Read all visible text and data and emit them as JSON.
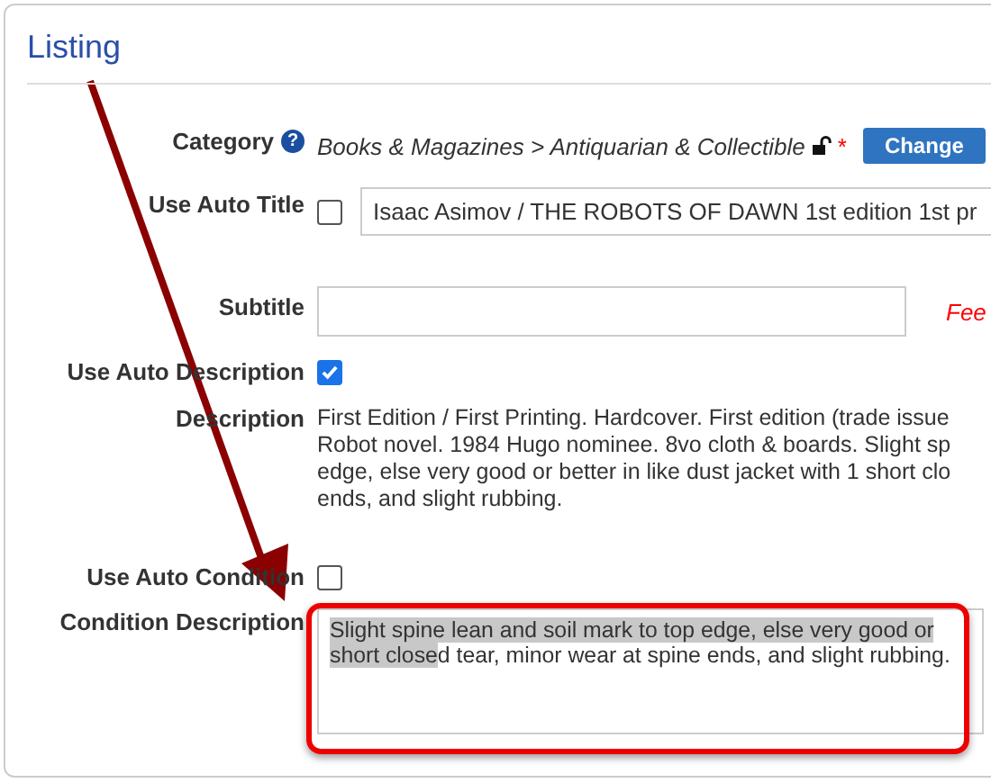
{
  "panel": {
    "title": "Listing"
  },
  "category": {
    "label": "Category",
    "help": "?",
    "path": "Books & Magazines > Antiquarian & Collectible",
    "required": "*",
    "button": "Change"
  },
  "auto_title": {
    "label": "Use Auto Title",
    "checked": false,
    "value": "Isaac Asimov / THE ROBOTS OF DAWN 1st edition 1st pr"
  },
  "subtitle": {
    "label": "Subtitle",
    "note": "Fee"
  },
  "auto_description": {
    "label": "Use Auto Description",
    "checked": true
  },
  "description": {
    "label": "Description",
    "lines": [
      "First Edition / First Printing. Hardcover. First edition (trade issue",
      "Robot novel. 1984 Hugo nominee. 8vo cloth & boards. Slight sp",
      "edge, else very good or better in like dust jacket with 1 short clo",
      "ends, and slight rubbing."
    ]
  },
  "auto_condition": {
    "label": "Use Auto Condition",
    "checked": false
  },
  "condition": {
    "label": "Condition Description",
    "lines": [
      [
        {
          "text": "Slight spine lean and soil mark to top edge, else very good or",
          "highlighted": true
        }
      ],
      [
        {
          "text": "short close",
          "highlighted": true
        },
        {
          "text": "d tear, minor wear at spine ends, and slight rubbing.",
          "highlighted": false
        }
      ]
    ]
  },
  "annotation": {
    "arrow": true,
    "highlight_frame": true
  }
}
